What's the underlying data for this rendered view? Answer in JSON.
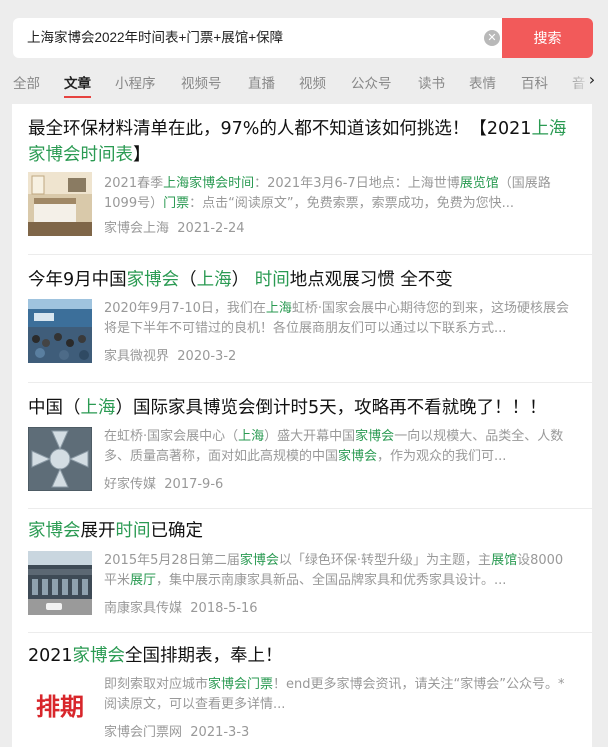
{
  "search": {
    "query": "上海家博会2022年时间表+门票+展馆+保障",
    "button_label": "搜索",
    "clear_icon": "clear-icon"
  },
  "tabs": [
    "全部",
    "文章",
    "小程序",
    "视频号",
    "直播",
    "视频",
    "公众号",
    "读书",
    "表情",
    "百科",
    "音"
  ],
  "active_tab": "文章",
  "results": [
    {
      "title_parts": [
        {
          "t": "最全环保材料清单在此，97%的人都不知道该如何挑选！【2021",
          "h": false
        },
        {
          "t": "上海家博会时间表",
          "h": true
        },
        {
          "t": "】",
          "h": false
        }
      ],
      "snippet_parts": [
        {
          "t": "2021春季",
          "h": false
        },
        {
          "t": "上海家博会时间",
          "h": true
        },
        {
          "t": "：2021年3月6-7日地点：上海世博",
          "h": false
        },
        {
          "t": "展览馆",
          "h": true
        },
        {
          "t": "（国展路1099号）",
          "h": false
        },
        {
          "t": "门票",
          "h": true
        },
        {
          "t": "：点击“阅读原文”，免费索票，索票成功，免费为您快...",
          "h": false
        }
      ],
      "source": "家博会上海",
      "date": "2021-2-24",
      "thumb": "bedroom-photo"
    },
    {
      "title_parts": [
        {
          "t": "今年9月中国",
          "h": false
        },
        {
          "t": "家博会",
          "h": true
        },
        {
          "t": "（",
          "h": false
        },
        {
          "t": "上海",
          "h": true
        },
        {
          "t": "）  ",
          "h": false
        },
        {
          "t": "时间",
          "h": true
        },
        {
          "t": "地点观展习惯 全不变",
          "h": false
        }
      ],
      "snippet_parts": [
        {
          "t": "2020年9月7-10日，我们在",
          "h": false
        },
        {
          "t": "上海",
          "h": true
        },
        {
          "t": "虹桥·国家会展中心期待您的到来，这场硬核展会将是下半年不可错过的良机！各位展商朋友们可以通过以下联系方式...",
          "h": false
        }
      ],
      "source": "家具微视界",
      "date": "2020-3-2",
      "thumb": "crowd-photo"
    },
    {
      "title_parts": [
        {
          "t": "中国（",
          "h": false
        },
        {
          "t": "上海",
          "h": true
        },
        {
          "t": "）国际家具博览会倒计时5天，攻略再不看就晚了！！！",
          "h": false
        }
      ],
      "snippet_parts": [
        {
          "t": "在虹桥·国家会展中心（",
          "h": false
        },
        {
          "t": "上海",
          "h": true
        },
        {
          "t": "）盛大开幕中国",
          "h": false
        },
        {
          "t": "家博会",
          "h": true
        },
        {
          "t": "一向以规模大、品类全、人数多、质量高著称，面对如此高规模的中国",
          "h": false
        },
        {
          "t": "家博会",
          "h": true
        },
        {
          "t": "，作为观众的我们可...",
          "h": false
        }
      ],
      "source": "好家传媒",
      "date": "2017-9-6",
      "thumb": "venue-aerial-photo"
    },
    {
      "title_parts": [
        {
          "t": "家博会",
          "h": true
        },
        {
          "t": "展开",
          "h": false
        },
        {
          "t": "时间",
          "h": true
        },
        {
          "t": "已确定",
          "h": false
        }
      ],
      "snippet_parts": [
        {
          "t": "2015年5月28日第二届",
          "h": false
        },
        {
          "t": "家博会",
          "h": true
        },
        {
          "t": "以「绿色环保·转型升级」为主题，主",
          "h": false
        },
        {
          "t": "展馆",
          "h": true
        },
        {
          "t": "设8000平米",
          "h": false
        },
        {
          "t": "展厅",
          "h": true
        },
        {
          "t": "，集中展示南康家具新品、全国品牌家具和优秀家具设计。...",
          "h": false
        }
      ],
      "source": "南康家具传媒",
      "date": "2018-5-16",
      "thumb": "building-photo"
    },
    {
      "title_parts": [
        {
          "t": "2021",
          "h": false
        },
        {
          "t": "家博会",
          "h": true
        },
        {
          "t": "全国排期表，奉上！",
          "h": false
        }
      ],
      "snippet_parts": [
        {
          "t": "即刻索取对应城市",
          "h": false
        },
        {
          "t": "家博会门票",
          "h": true
        },
        {
          "t": "！end更多家博会资讯，请关注“家博会”公众号。* 阅读原文，可以查看更多详情...",
          "h": false
        }
      ],
      "source": "家博会门票网",
      "date": "2021-3-3",
      "thumb": "schedule-graphic",
      "thumb_text": "排期"
    }
  ]
}
